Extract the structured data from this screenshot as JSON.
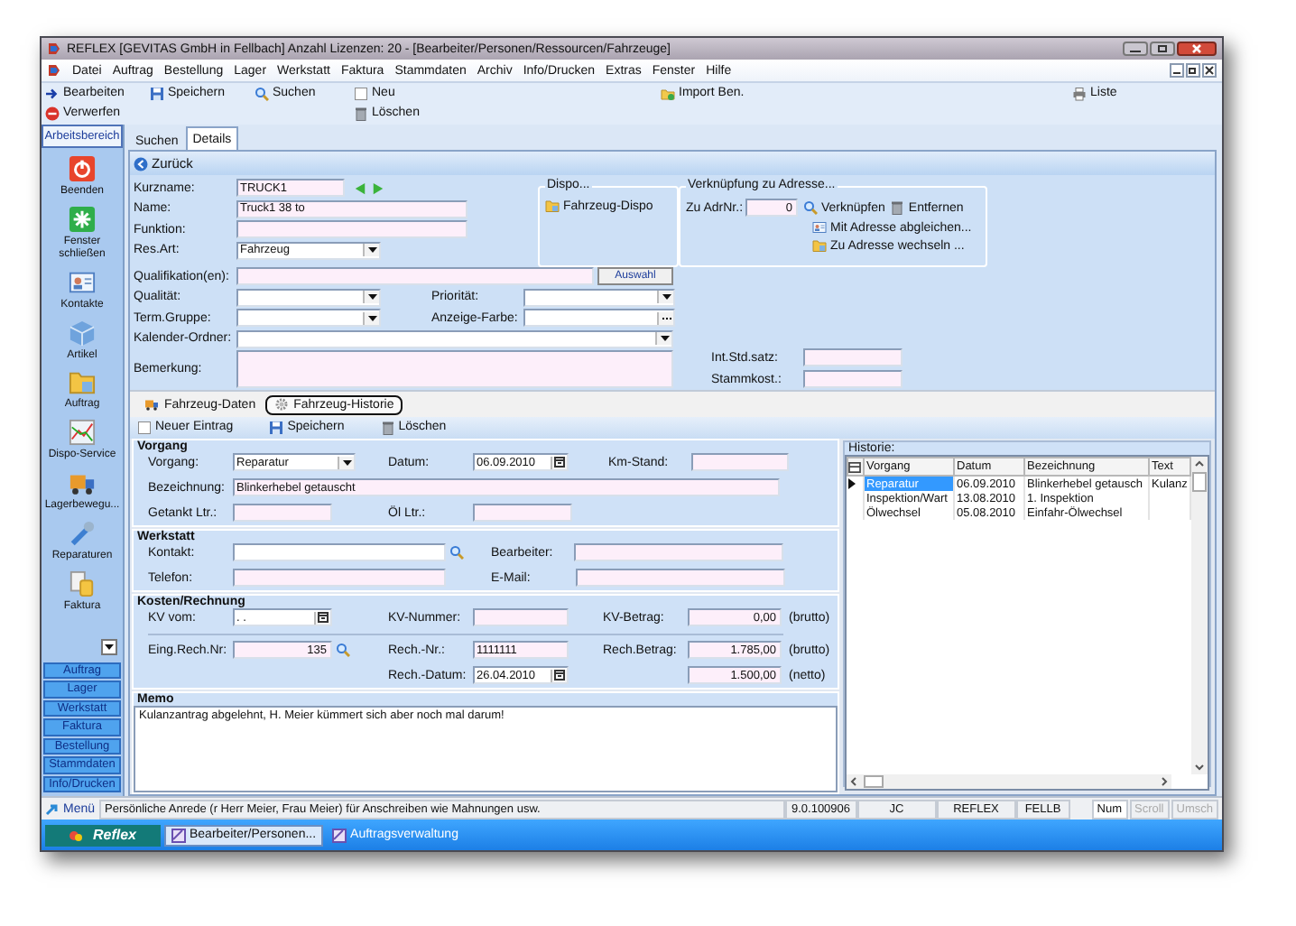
{
  "window": {
    "title": "REFLEX [GEVITAS GmbH in Fellbach] Anzahl Lizenzen: 20 - [Bearbeiter/Personen/Ressourcen/Fahrzeuge]"
  },
  "menu": [
    "Datei",
    "Auftrag",
    "Bestellung",
    "Lager",
    "Werkstatt",
    "Faktura",
    "Stammdaten",
    "Archiv",
    "Info/Drucken",
    "Extras",
    "Fenster",
    "Hilfe"
  ],
  "toolbar": [
    [
      "Bearbeiten",
      "Verwerfen"
    ],
    [
      "Speichern"
    ],
    [
      "Suchen"
    ],
    [
      "Neu",
      "Löschen"
    ],
    [
      "Import Ben."
    ],
    [
      "Liste"
    ]
  ],
  "sidebar": {
    "header": "Arbeitsbereich",
    "items": [
      "Beenden",
      "Fenster schließen",
      "Kontakte",
      "Artikel",
      "Auftrag",
      "Dispo-Service",
      "Lagerbewegu...",
      "Reparaturen",
      "Faktura"
    ],
    "groups": [
      "Auftrag",
      "Lager",
      "Werkstatt",
      "Faktura",
      "Bestellung",
      "Stammdaten",
      "Info/Drucken"
    ]
  },
  "tabs": [
    {
      "label": "Suchen",
      "selected": false
    },
    {
      "label": "Details",
      "selected": true
    }
  ],
  "back": "Zurück",
  "details": {
    "fields_main": [
      [
        {
          "label": "Kurzname:",
          "value": "TRUCK1",
          "kind": "text",
          "highlighted": true
        }
      ],
      [
        {
          "label": "Name:",
          "value": "Truck1 38 to",
          "kind": "text",
          "highlighted": true
        }
      ],
      [
        {
          "label": "Funktion:",
          "kind": "text",
          "highlighted": true
        }
      ],
      [
        {
          "label": "Res.Art:",
          "value": "Fahrzeug",
          "kind": "combo",
          "highlighted": false
        }
      ]
    ],
    "dispo": {
      "title": "Dispo...",
      "button": "Fahrzeug-Dispo"
    },
    "address_link": {
      "title": "Verknüpfung zu Adresse...",
      "field": {
        "label": "Zu AdrNr.:",
        "value": "0",
        "kind": "number",
        "highlighted": true
      },
      "actions": [
        "Verknüpfen",
        "Entfernen",
        "Mit Adresse abgleichen...",
        "Zu Adresse wechseln ..."
      ]
    },
    "fields_more": [
      [
        {
          "label": "Qualifikation(en):",
          "kind": "text",
          "highlighted": true,
          "button": "Auswahl"
        }
      ],
      [
        {
          "label": "Qualität:",
          "kind": "combo",
          "highlighted": false
        },
        {
          "label": "Priorität:",
          "kind": "combo",
          "highlighted": false
        }
      ],
      [
        {
          "label": "Term.Gruppe:",
          "kind": "combo",
          "highlighted": false
        },
        {
          "label": "Anzeige-Farbe:",
          "kind": "ellipsis",
          "highlighted": false
        }
      ],
      [
        {
          "label": "Kalender-Ordner:",
          "kind": "combo",
          "highlighted": false
        }
      ],
      [
        {
          "label": "Bemerkung:",
          "kind": "textarea",
          "highlighted": true
        }
      ]
    ],
    "rates": [
      {
        "label": "Int.Std.satz:",
        "kind": "text",
        "highlighted": true
      },
      {
        "label": "Stammkost.:",
        "kind": "text",
        "highlighted": true
      }
    ]
  },
  "subtabs": [
    {
      "label": "Fahrzeug-Daten",
      "selected": false
    },
    {
      "label": "Fahrzeug-Historie",
      "selected": true
    }
  ],
  "subtoolbar": [
    "Neuer Eintrag",
    "Speichern",
    "Löschen"
  ],
  "sections": [
    {
      "title": "Vorgang",
      "rows": [
        [
          {
            "label": "Vorgang:",
            "value": "Reparatur",
            "kind": "combo",
            "highlighted": false
          },
          {
            "label": "Datum:",
            "value": "06.09.2010",
            "kind": "date",
            "highlighted": false
          },
          {
            "label": "Km-Stand:",
            "kind": "text",
            "highlighted": true
          }
        ],
        [
          {
            "label": "Bezeichnung:",
            "value": "Blinkerhebel getauscht",
            "kind": "text",
            "highlighted": true
          }
        ],
        [
          {
            "label": "Getankt Ltr.:",
            "kind": "text",
            "highlighted": true
          },
          {
            "label": "Öl Ltr.:",
            "kind": "text",
            "highlighted": true
          }
        ]
      ]
    },
    {
      "title": "Werkstatt",
      "rows": [
        [
          {
            "label": "Kontakt:",
            "kind": "text",
            "highlighted": false,
            "lookup": true
          },
          {
            "label": "Bearbeiter:",
            "kind": "text",
            "highlighted": true
          }
        ],
        [
          {
            "label": "Telefon:",
            "kind": "text",
            "highlighted": true
          },
          {
            "label": "E-Mail:",
            "kind": "text",
            "highlighted": true
          }
        ]
      ]
    },
    {
      "title": "Kosten/Rechnung",
      "rows": [
        [
          {
            "label": "KV vom:",
            "value": ". .",
            "kind": "date",
            "highlighted": false
          },
          {
            "label": "KV-Nummer:",
            "kind": "text",
            "highlighted": true
          },
          {
            "label": "KV-Betrag:",
            "value": "0,00",
            "kind": "number",
            "highlighted": true,
            "suffix": "(brutto)"
          }
        ],
        [
          {
            "label": "Eing.Rech.Nr:",
            "value": "135",
            "kind": "number",
            "highlighted": true,
            "lookup": true
          },
          {
            "label": "Rech.-Nr.:",
            "value": "1111111",
            "kind": "text",
            "highlighted": true
          },
          {
            "label": "Rech.Betrag:",
            "value": "1.785,00",
            "kind": "number",
            "highlighted": true,
            "suffix": "(brutto)"
          }
        ],
        [
          "",
          {
            "label": "Rech.-Datum:",
            "value": "26.04.2010",
            "kind": "date",
            "highlighted": false
          },
          {
            "value": "1.500,00",
            "kind": "number",
            "highlighted": true,
            "suffix": "(netto)"
          }
        ]
      ]
    }
  ],
  "memo": {
    "title": "Memo",
    "text": "Kulanzantrag abgelehnt, H. Meier kümmert sich aber noch mal darum!"
  },
  "history": {
    "title": "Historie:",
    "columns": [
      "Vorgang",
      "Datum",
      "Bezeichnung",
      "Text"
    ],
    "rows": [
      {
        "cells": [
          "Reparatur",
          "06.09.2010",
          "Blinkerhebel getausch",
          "Kulanz"
        ],
        "selected": true
      },
      {
        "cells": [
          "Inspektion/Wart",
          "13.08.2010",
          "1. Inspektion"
        ],
        "selected": false
      },
      {
        "cells": [
          "Ölwechsel",
          "05.08.2010",
          "Einfahr-Ölwechsel"
        ],
        "selected": false
      }
    ]
  },
  "status_bar": {
    "menu_button": "Menü",
    "message": "Persönliche Anrede (r Herr Meier, Frau Meier) für Anschreiben wie Mahnungen usw.",
    "cells": [
      "9.0.100906",
      "JC",
      "REFLEX",
      "FELLB"
    ],
    "keys": [
      {
        "label": "Num",
        "on": true
      },
      {
        "label": "Scroll",
        "on": false
      },
      {
        "label": "Umsch",
        "on": false
      }
    ]
  },
  "taskbar": {
    "start": "Reflex",
    "tasks": [
      {
        "label": "Bearbeiter/Personen...",
        "selected": true
      },
      {
        "label": "Auftragsverwaltung",
        "selected": false
      }
    ]
  }
}
